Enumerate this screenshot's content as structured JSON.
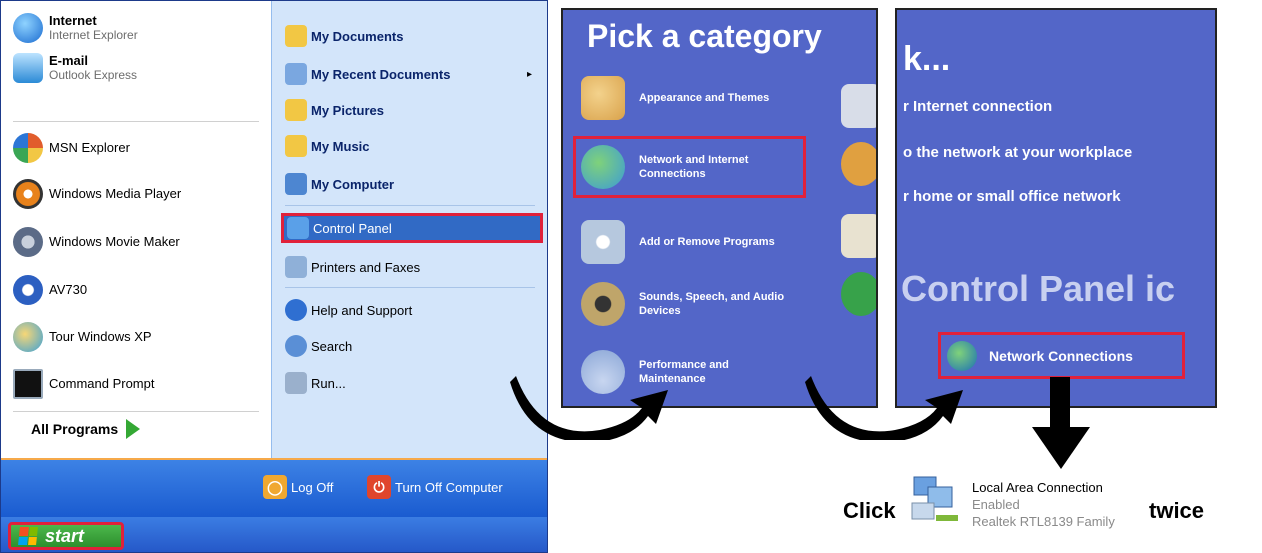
{
  "start_menu": {
    "left_items": [
      {
        "name": "internet-item",
        "label": "Internet",
        "sub": "Internet Explorer",
        "bold": true,
        "color": "#1a6bd0"
      },
      {
        "name": "email-item",
        "label": "E-mail",
        "sub": "Outlook Express",
        "bold": true,
        "color": "#2b8ad6"
      },
      {
        "name": "msn-explorer-item",
        "label": "MSN Explorer",
        "sub": "",
        "bold": false,
        "color": "#e15d2c"
      },
      {
        "name": "media-player-item",
        "label": "Windows Media Player",
        "sub": "",
        "bold": false,
        "color": "#e8821b"
      },
      {
        "name": "movie-maker-item",
        "label": "Windows Movie Maker",
        "sub": "",
        "bold": false,
        "color": "#5b6b87"
      },
      {
        "name": "av730-item",
        "label": "AV730",
        "sub": "",
        "bold": false,
        "color": "#2c5fc1"
      },
      {
        "name": "tour-xp-item",
        "label": "Tour Windows XP",
        "sub": "",
        "bold": false,
        "color": "#3aa0d8"
      },
      {
        "name": "command-prompt-item",
        "label": "Command Prompt",
        "sub": "",
        "bold": false,
        "color": "#111111"
      }
    ],
    "all_programs": "All Programs",
    "right_items": [
      {
        "name": "my-documents-item",
        "label": "My Documents",
        "bold": true,
        "color": "#f2c744"
      },
      {
        "name": "my-recent-documents-item",
        "label": "My Recent Documents",
        "bold": true,
        "color": "#7aa7e0"
      },
      {
        "name": "my-pictures-item",
        "label": "My Pictures",
        "bold": true,
        "color": "#f2c744"
      },
      {
        "name": "my-music-item",
        "label": "My Music",
        "bold": true,
        "color": "#f2c744"
      },
      {
        "name": "my-computer-item",
        "label": "My Computer",
        "bold": true,
        "color": "#4d86d1"
      },
      {
        "name": "control-panel-item",
        "label": "Control Panel",
        "bold": false,
        "color": "#5aa0e8"
      },
      {
        "name": "printers-faxes-item",
        "label": "Printers and Faxes",
        "bold": false,
        "color": "#8fb0d8"
      },
      {
        "name": "help-support-item",
        "label": "Help and Support",
        "bold": false,
        "color": "#2f6fd1"
      },
      {
        "name": "search-item",
        "label": "Search",
        "bold": false,
        "color": "#5a8fd6"
      },
      {
        "name": "run-item",
        "label": "Run...",
        "bold": false,
        "color": "#9ab0cc"
      }
    ],
    "log_off": "Log Off",
    "turn_off": "Turn Off Computer",
    "start": "start"
  },
  "category_panel": {
    "title": "Pick a category",
    "items": [
      {
        "name": "category-appearance",
        "label": "Appearance and Themes",
        "color": "#d9a24b"
      },
      {
        "name": "category-network",
        "label": "Network and Internet Connections",
        "color": "#3c9bd6"
      },
      {
        "name": "category-add-remove",
        "label": "Add or Remove Programs",
        "color": "#b6c8de"
      },
      {
        "name": "category-sounds",
        "label": "Sounds, Speech, and Audio Devices",
        "color": "#bfa56a"
      },
      {
        "name": "category-performance",
        "label": "Performance and Maintenance",
        "color": "#8aa6d6"
      }
    ]
  },
  "network_panel": {
    "title": "k...",
    "lines": [
      "r Internet connection",
      "o the network at your workplace",
      "r home or small office network"
    ],
    "cp_icons": "Control Panel ic",
    "connections": "Network Connections"
  },
  "local_area": {
    "click": "Click",
    "twice": "twice",
    "name": "Local Area Connection",
    "status": "Enabled",
    "adapter": "Realtek RTL8139 Family"
  },
  "colors": {
    "highlight": "#e0213a",
    "xp_blue": "#316ac5",
    "panel_blue": "#5366c8"
  }
}
